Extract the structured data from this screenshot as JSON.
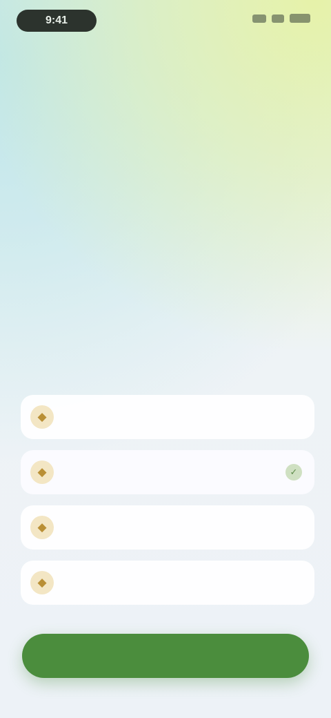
{
  "status_bar": {
    "time": "9:41"
  },
  "headline": "",
  "categories": [
    {
      "label": "",
      "icon": "category-icon",
      "selected": false
    },
    {
      "label": "",
      "icon": "category-icon",
      "selected": true
    },
    {
      "label": "",
      "icon": "category-icon",
      "selected": false
    },
    {
      "label": "",
      "icon": "category-icon",
      "selected": false
    }
  ],
  "actions": {
    "continue_label": ""
  },
  "colors": {
    "primary": "#4b8d3d",
    "headline": "#2a4a4e",
    "icon_bg": "#f3e6c4"
  }
}
